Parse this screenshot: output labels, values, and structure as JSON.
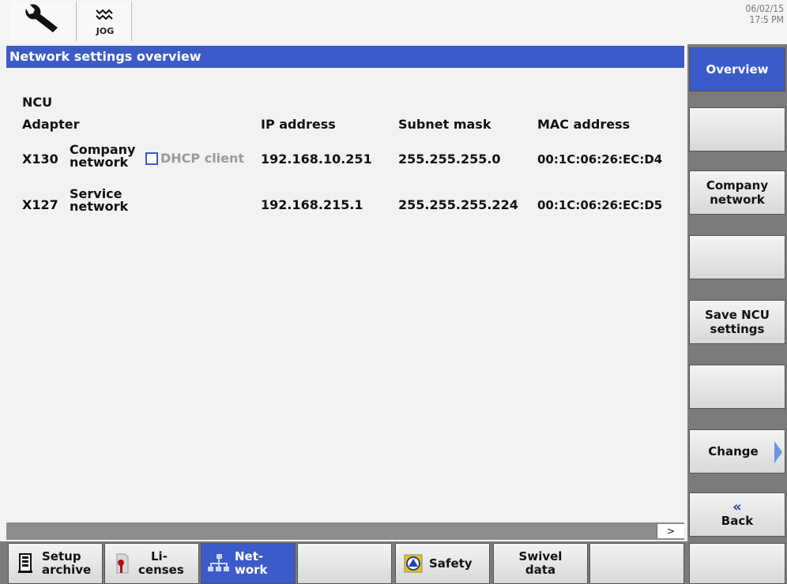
{
  "status_bar": {
    "mode_label": "JOG",
    "date": "06/02/15",
    "time": "17:5 PM"
  },
  "panel": {
    "title": "Network settings overview"
  },
  "table": {
    "group_label": "NCU",
    "headers": {
      "adapter": "Adapter",
      "ip": "IP address",
      "subnet": "Subnet mask",
      "mac": "MAC address"
    },
    "rows": [
      {
        "port": "X130",
        "name_line1": "Company",
        "name_line2": "network",
        "dhcp_label": "DHCP client",
        "dhcp_checked": false,
        "ip": "192.168.10.251",
        "subnet": "255.255.255.0",
        "mac": "00:1C:06:26:EC:D4"
      },
      {
        "port": "X127",
        "name_line1": "Service",
        "name_line2": "network",
        "ip": "192.168.215.1",
        "subnet": "255.255.255.224",
        "mac": "00:1C:06:26:EC:D5"
      }
    ]
  },
  "scroll": {
    "right_arrow": ">"
  },
  "right_softkeys": {
    "overview": "Overview",
    "company_network_1": "Company",
    "company_network_2": "network",
    "save_ncu_1": "Save NCU",
    "save_ncu_2": "settings",
    "change": "Change",
    "back_chevron": "«",
    "back": "Back"
  },
  "bottom_softkeys": {
    "setup_archive_1": "Setup",
    "setup_archive_2": "archive",
    "licenses_1": "Li-",
    "licenses_2": "censes",
    "network_1": "Net-",
    "network_2": "work",
    "safety": "Safety",
    "swivel_1": "Swivel",
    "swivel_2": "data"
  },
  "colors": {
    "accent_blue": "#3c5bc8",
    "softkey_gray": "#7b7b7b",
    "disabled_text": "#9a9a9a"
  },
  "icons": [
    "wrench-icon",
    "jog-icon",
    "setup-archive-icon",
    "license-key-icon",
    "network-icon",
    "safety-icon",
    "change-arrow-icon",
    "back-icon"
  ]
}
